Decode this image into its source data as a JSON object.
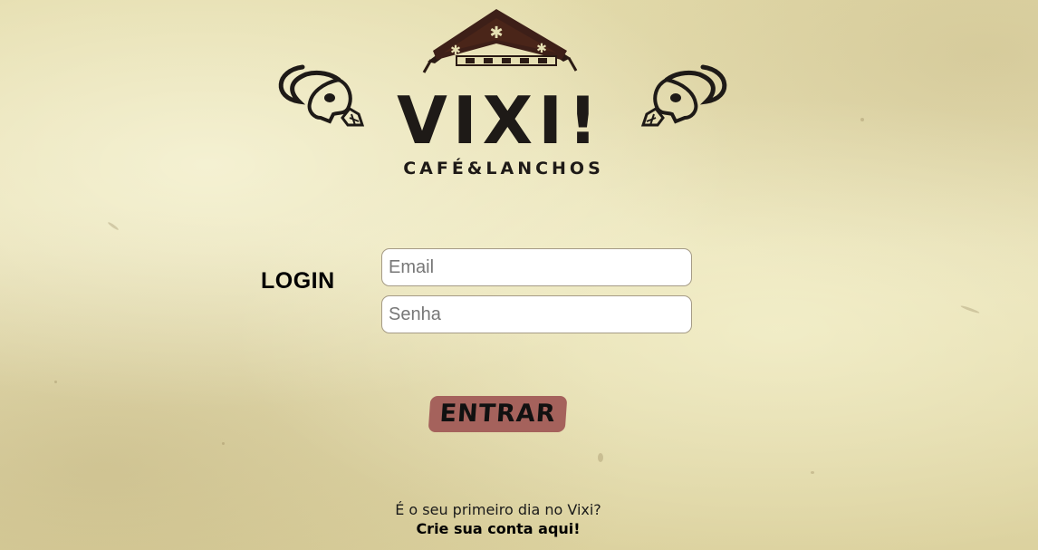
{
  "brand": {
    "name": "VIXI!",
    "tagline": "CAFÉ&LANCHOS",
    "logo_color": "#1e1a17",
    "roof_color": "#3d1f18"
  },
  "login": {
    "title": "LOGIN",
    "email_placeholder": "Email",
    "email_value": "",
    "password_placeholder": "Senha",
    "password_value": "",
    "submit_label": "ENTRAR",
    "submit_color": "#a5625c"
  },
  "signup": {
    "question": "É o seu primeiro dia no Vixi?",
    "link_label": "Crie sua conta aqui!"
  },
  "icons": {
    "left_ornament": "ox-skull-icon",
    "right_ornament": "ox-skull-icon",
    "roof_ornament": "star-roof-icon"
  }
}
